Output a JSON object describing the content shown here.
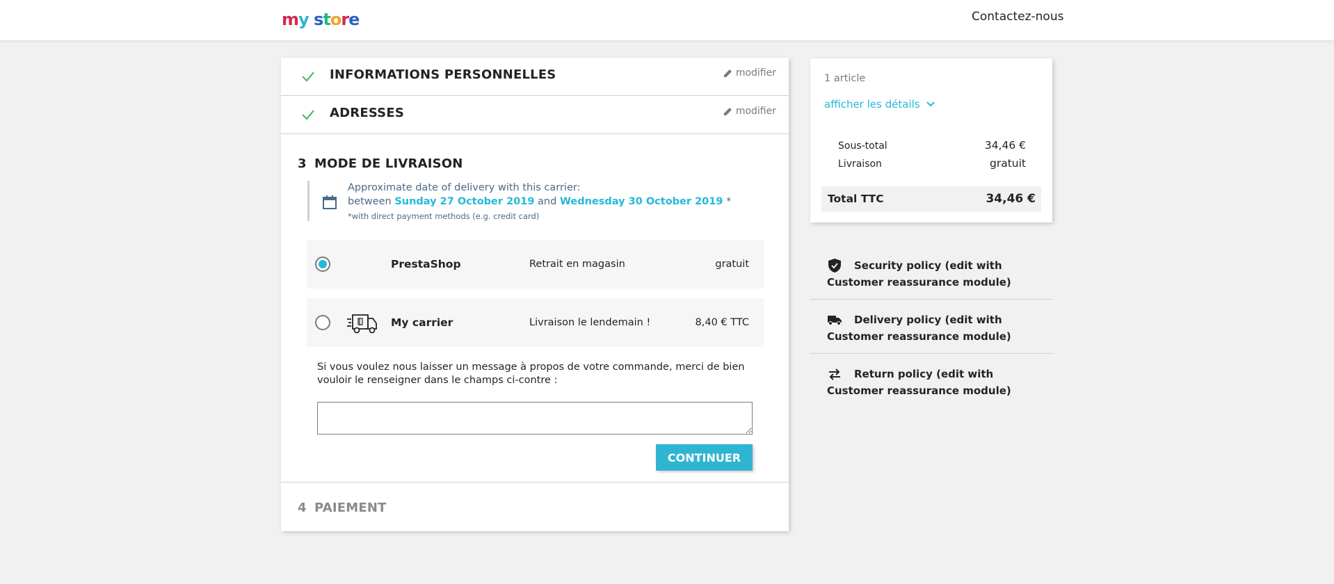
{
  "header": {
    "logo_letters": [
      "m",
      "y",
      " ",
      "s",
      "t",
      "o",
      "r",
      "e"
    ],
    "logo_colors": [
      "#d6264f",
      "#2fb5d2",
      "#ffffff",
      "#2a63c0",
      "#23b684",
      "#f0a42c",
      "#d6264f",
      "#2a63c0"
    ],
    "contact_label": "Contactez-nous"
  },
  "checkout": {
    "step1": {
      "title": "INFORMATIONS PERSONNELLES",
      "edit_label": "modifier"
    },
    "step2": {
      "title": "ADRESSES",
      "edit_label": "modifier"
    },
    "step3": {
      "number": "3",
      "title": "MODE DE LIVRAISON",
      "delivery_info": {
        "line1": "Approximate date of delivery with this carrier:",
        "prefix": "between",
        "date_from": "Sunday 27 October 2019",
        "connector": "and",
        "date_to": "Wednesday 30 October 2019",
        "asterisk": "*",
        "note": "*with direct payment methods (e.g. credit card)"
      },
      "carriers": [
        {
          "name": "PrestaShop",
          "delay": "Retrait en magasin",
          "price": "gratuit",
          "selected": true,
          "icon": "none"
        },
        {
          "name": "My carrier",
          "delay": "Livraison le lendemain !",
          "price": "8,40 € TTC",
          "selected": false,
          "icon": "truck-icon"
        }
      ],
      "message_label": "Si vous voulez nous laisser un message à propos de votre commande, merci de bien vouloir le renseigner dans le champs ci-contre :",
      "message_value": "",
      "continue_label": "CONTINUER"
    },
    "step4": {
      "number": "4",
      "title": "PAIEMENT"
    }
  },
  "summary": {
    "count": "1 article",
    "details_label": "afficher les détails",
    "subtotal_label": "Sous-total",
    "subtotal_value": "34,46 €",
    "shipping_label": "Livraison",
    "shipping_value": "gratuit",
    "total_label": "Total TTC",
    "total_value": "34,46 €"
  },
  "reassurance": [
    {
      "icon": "shield-icon",
      "text": "Security policy (edit with Customer reassurance module)"
    },
    {
      "icon": "truck-icon",
      "text": "Delivery policy (edit with Customer reassurance module)"
    },
    {
      "icon": "swap-arrows-icon",
      "text": "Return policy (edit with Customer reassurance module)"
    }
  ],
  "colors": {
    "accent": "#2fb5d2",
    "check": "#4cbb6c",
    "background": "#f1f1f1"
  }
}
